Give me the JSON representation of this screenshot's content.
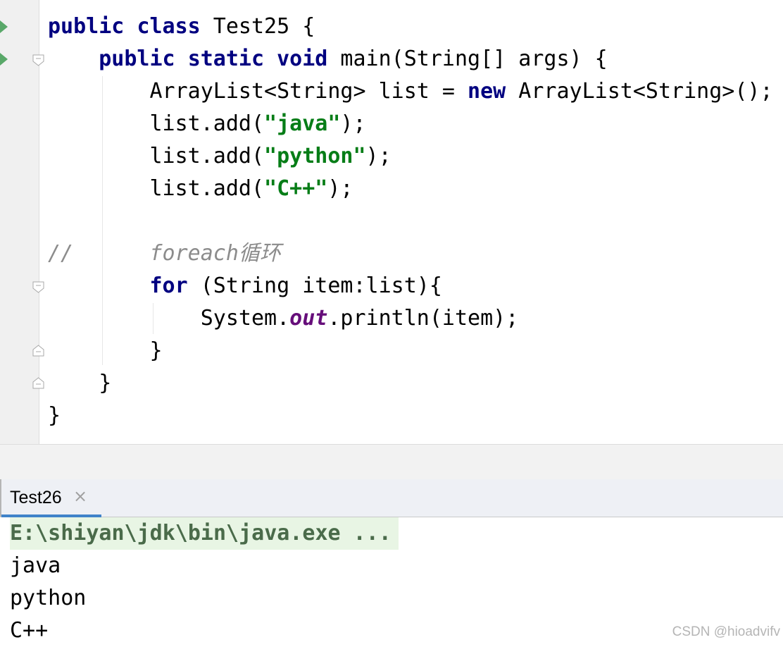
{
  "editor": {
    "lines": [
      [
        "public",
        " ",
        "class",
        " Test25 {"
      ],
      [
        "    ",
        "public",
        " ",
        "static",
        " ",
        "void",
        " main(String[] args) {"
      ],
      [
        "        ArrayList<String> list = ",
        "new",
        " ArrayList<String>();"
      ],
      [
        "        list.add(",
        "\"java\"",
        ");"
      ],
      [
        "        list.add(",
        "\"python\"",
        ");"
      ],
      [
        "        list.add(",
        "\"C++\"",
        ");"
      ],
      [
        ""
      ],
      [
        "//      foreach循环"
      ],
      [
        "        ",
        "for",
        " (String item:list){"
      ],
      [
        "            System.",
        "out",
        ".println(item);"
      ],
      [
        "        }"
      ],
      [
        "    }"
      ],
      [
        "}"
      ]
    ]
  },
  "run_panel": {
    "tab_label": "Test26",
    "tab_close": "×",
    "command_line": "E:\\shiyan\\jdk\\bin\\java.exe ...",
    "output": [
      "java",
      "python",
      "C++"
    ]
  },
  "watermark": "CSDN @hioadvifv",
  "colors": {
    "keyword": "#000080",
    "string": "#067d17",
    "comment": "#8c8c8c",
    "static_field": "#660e7a",
    "run_marker": "#59a869",
    "tab_accent": "#4083c9"
  },
  "icons": {
    "run": "run-gutter-icon",
    "fold": "fold-marker-icon",
    "close": "close-icon"
  }
}
